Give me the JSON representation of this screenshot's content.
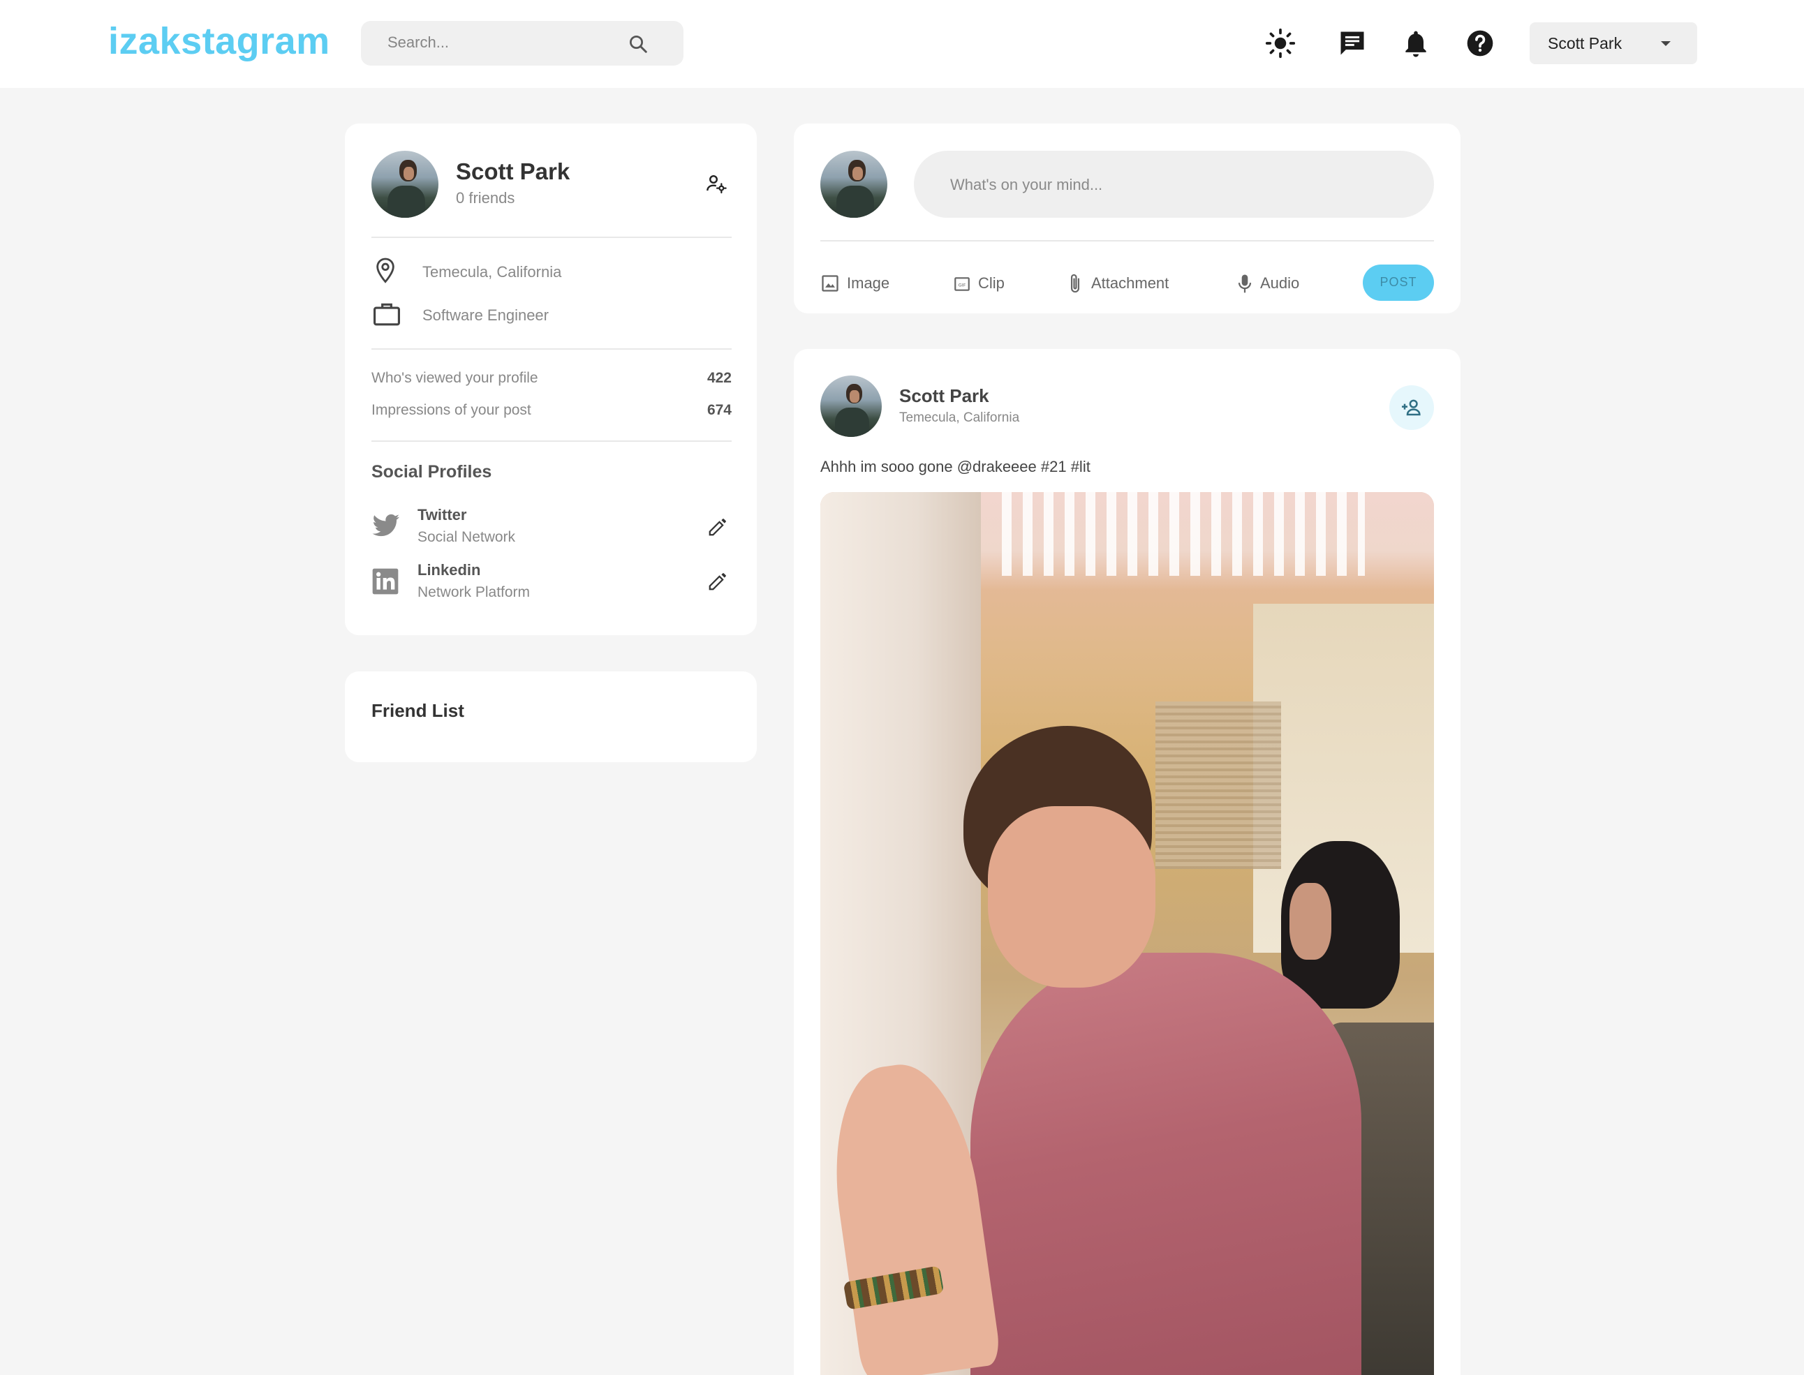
{
  "app": {
    "logo": "izakstagram"
  },
  "header": {
    "search_placeholder": "Search...",
    "icons": [
      "brightness-icon",
      "message-icon",
      "notification-bell-icon",
      "help-icon"
    ],
    "user_menu": {
      "selected": "Scott Park"
    }
  },
  "profile": {
    "name": "Scott Park",
    "friends": "0 friends",
    "location": "Temecula, California",
    "occupation": "Software Engineer",
    "stats": [
      {
        "label": "Who's viewed your profile",
        "value": "422"
      },
      {
        "label": "Impressions of your post",
        "value": "674"
      }
    ],
    "social_title": "Social Profiles",
    "social": [
      {
        "name": "Twitter",
        "type": "Social Network"
      },
      {
        "name": "Linkedin",
        "type": "Network Platform"
      }
    ]
  },
  "friend_list": {
    "title": "Friend List"
  },
  "composer": {
    "placeholder": "What's on your mind...",
    "actions": [
      "Image",
      "Clip",
      "Attachment",
      "Audio"
    ],
    "post_label": "POST"
  },
  "post": {
    "author": "Scott Park",
    "location": "Temecula, California",
    "caption": "Ahhh im sooo gone @drakeeee #21 #lit"
  },
  "colors": {
    "brand": "#5ccdf2",
    "background": "#f5f5f5",
    "post_button": "#5ccdf2",
    "add_friend_bg": "#e6f7fc"
  }
}
